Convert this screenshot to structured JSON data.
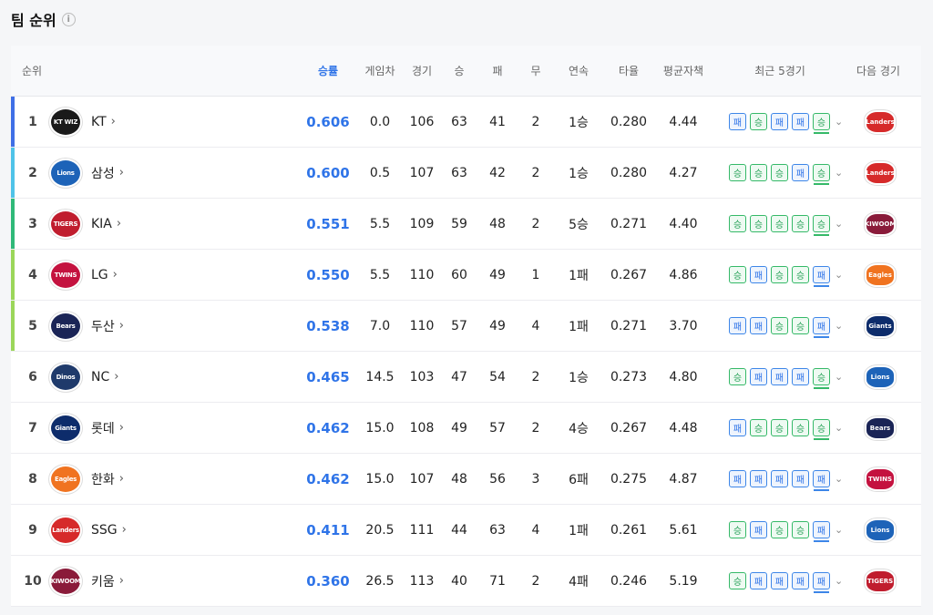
{
  "page": {
    "title": "팀 순위",
    "info_icon": "i"
  },
  "columns": {
    "rank": "순위",
    "pct": "승률",
    "gb": "게임차",
    "games": "경기",
    "wins": "승",
    "losses": "패",
    "draws": "무",
    "streak": "연속",
    "avg": "타율",
    "era": "평균자책",
    "recent": "최근 5경기",
    "next": "다음 경기"
  },
  "colors": {
    "accent": "#2f74e8",
    "win": "#35b968",
    "loss": "#3d86e8"
  },
  "rows": [
    {
      "rank": "1",
      "logo": "KT WIZ",
      "logo_color": "#1a1a1a",
      "team": "KT",
      "stripe": "#3f6fe6",
      "pct": "0.606",
      "gb": "0.0",
      "games": "106",
      "wins": "63",
      "losses": "41",
      "draws": "2",
      "streak": "1승",
      "avg": "0.280",
      "era": "4.44",
      "recent": [
        "패",
        "승",
        "패",
        "패",
        "승"
      ],
      "next_logo": "Landers",
      "next_color": "#d62a2a"
    },
    {
      "rank": "2",
      "logo": "Lions",
      "logo_color": "#1d63b8",
      "team": "삼성",
      "stripe": "#4fc3e8",
      "pct": "0.600",
      "gb": "0.5",
      "games": "107",
      "wins": "63",
      "losses": "42",
      "draws": "2",
      "streak": "1승",
      "avg": "0.280",
      "era": "4.27",
      "recent": [
        "승",
        "승",
        "승",
        "패",
        "승"
      ],
      "next_logo": "Landers",
      "next_color": "#d62a2a"
    },
    {
      "rank": "3",
      "logo": "TIGERS",
      "logo_color": "#c01d2e",
      "team": "KIA",
      "stripe": "#2fb978",
      "pct": "0.551",
      "gb": "5.5",
      "games": "109",
      "wins": "59",
      "losses": "48",
      "draws": "2",
      "streak": "5승",
      "avg": "0.271",
      "era": "4.40",
      "recent": [
        "승",
        "승",
        "승",
        "승",
        "승"
      ],
      "next_logo": "KIWOOM",
      "next_color": "#8a1b3a"
    },
    {
      "rank": "4",
      "logo": "TWINS",
      "logo_color": "#c4123f",
      "team": "LG",
      "stripe": "#9bd65a",
      "pct": "0.550",
      "gb": "5.5",
      "games": "110",
      "wins": "60",
      "losses": "49",
      "draws": "1",
      "streak": "1패",
      "avg": "0.267",
      "era": "4.86",
      "recent": [
        "승",
        "패",
        "승",
        "승",
        "패"
      ],
      "next_logo": "Eagles",
      "next_color": "#f07320"
    },
    {
      "rank": "5",
      "logo": "Bears",
      "logo_color": "#1a2456",
      "team": "두산",
      "stripe": "#9bd65a",
      "pct": "0.538",
      "gb": "7.0",
      "games": "110",
      "wins": "57",
      "losses": "49",
      "draws": "4",
      "streak": "1패",
      "avg": "0.271",
      "era": "3.70",
      "recent": [
        "패",
        "패",
        "승",
        "승",
        "패"
      ],
      "next_logo": "Giants",
      "next_color": "#0d2c6b"
    },
    {
      "rank": "6",
      "logo": "Dinos",
      "logo_color": "#1f3a6b",
      "team": "NC",
      "stripe": "",
      "pct": "0.465",
      "gb": "14.5",
      "games": "103",
      "wins": "47",
      "losses": "54",
      "draws": "2",
      "streak": "1승",
      "avg": "0.273",
      "era": "4.80",
      "recent": [
        "승",
        "패",
        "패",
        "패",
        "승"
      ],
      "next_logo": "Lions",
      "next_color": "#1d63b8"
    },
    {
      "rank": "7",
      "logo": "Giants",
      "logo_color": "#0d2c6b",
      "team": "롯데",
      "stripe": "",
      "pct": "0.462",
      "gb": "15.0",
      "games": "108",
      "wins": "49",
      "losses": "57",
      "draws": "2",
      "streak": "4승",
      "avg": "0.267",
      "era": "4.48",
      "recent": [
        "패",
        "승",
        "승",
        "승",
        "승"
      ],
      "next_logo": "Bears",
      "next_color": "#1a2456"
    },
    {
      "rank": "8",
      "logo": "Eagles",
      "logo_color": "#f07320",
      "team": "한화",
      "stripe": "",
      "pct": "0.462",
      "gb": "15.0",
      "games": "107",
      "wins": "48",
      "losses": "56",
      "draws": "3",
      "streak": "6패",
      "avg": "0.275",
      "era": "4.87",
      "recent": [
        "패",
        "패",
        "패",
        "패",
        "패"
      ],
      "next_logo": "TWINS",
      "next_color": "#c4123f"
    },
    {
      "rank": "9",
      "logo": "Landers",
      "logo_color": "#d62a2a",
      "team": "SSG",
      "stripe": "",
      "pct": "0.411",
      "gb": "20.5",
      "games": "111",
      "wins": "44",
      "losses": "63",
      "draws": "4",
      "streak": "1패",
      "avg": "0.261",
      "era": "5.61",
      "recent": [
        "승",
        "패",
        "승",
        "승",
        "패"
      ],
      "next_logo": "Lions",
      "next_color": "#1d63b8"
    },
    {
      "rank": "10",
      "logo": "KIWOOM",
      "logo_color": "#8a1b3a",
      "team": "키움",
      "stripe": "",
      "pct": "0.360",
      "gb": "26.5",
      "games": "113",
      "wins": "40",
      "losses": "71",
      "draws": "2",
      "streak": "4패",
      "avg": "0.246",
      "era": "5.19",
      "recent": [
        "승",
        "패",
        "패",
        "패",
        "패"
      ],
      "next_logo": "TIGERS",
      "next_color": "#c01d2e"
    }
  ]
}
